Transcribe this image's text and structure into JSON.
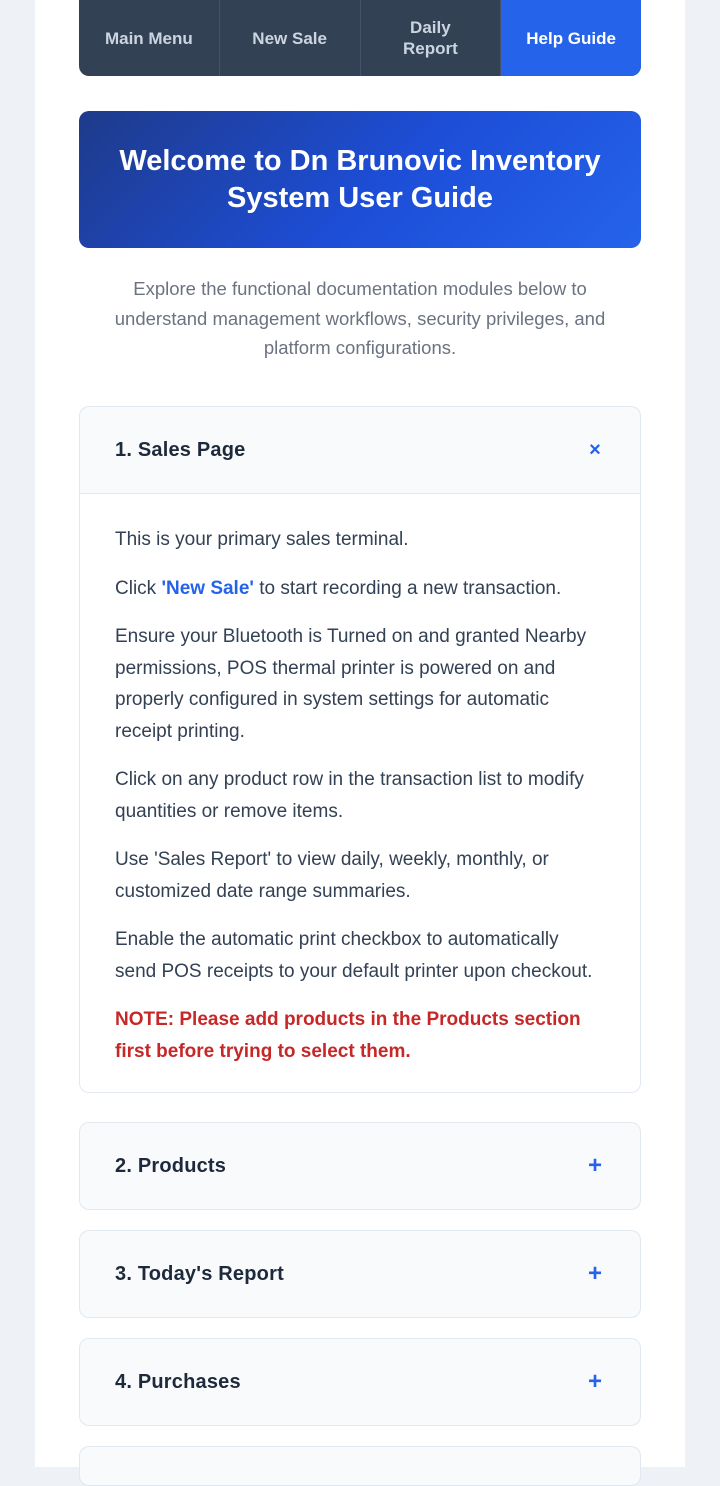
{
  "nav": {
    "items": [
      {
        "label": "Main Menu"
      },
      {
        "label": "New Sale"
      },
      {
        "label": "Daily Report"
      },
      {
        "label": "Help Guide"
      }
    ]
  },
  "hero": {
    "title": "Welcome to Dn Brunovic Inventory System User Guide"
  },
  "intro": "Explore the functional documentation modules below to understand management workflows, security privileges, and platform configurations.",
  "sections": [
    {
      "title": "1. Sales Page",
      "icon": "close-icon",
      "expanded": true,
      "body": {
        "p1": "This is your primary sales terminal.",
        "p2_prefix": "Click ",
        "p2_link": "'New Sale'",
        "p2_suffix": " to start recording a new transaction.",
        "p3": "Ensure your Bluetooth is Turned on and granted Nearby permissions, POS thermal printer is powered on and properly configured in system settings for automatic receipt printing.",
        "p4": "Click on any product row in the transaction list to modify quantities or remove items.",
        "p5": "Use 'Sales Report' to view daily, weekly, monthly, or customized date range summaries.",
        "p6": "Enable the automatic print checkbox to automatically send POS receipts to your default printer upon checkout.",
        "note": "NOTE: Please add products in the Products section first before trying to select them."
      }
    },
    {
      "title": "2. Products",
      "icon": "plus-icon",
      "expanded": false
    },
    {
      "title": "3. Today's Report",
      "icon": "plus-icon",
      "expanded": false
    },
    {
      "title": "4. Purchases",
      "icon": "plus-icon",
      "expanded": false
    }
  ],
  "icons": {
    "close": "×",
    "plus": "+"
  },
  "colors": {
    "accent": "#2563eb",
    "nav_bg": "#334155",
    "note_red": "#c62828",
    "hero_start": "#1e3a8a",
    "hero_end": "#2563eb"
  }
}
